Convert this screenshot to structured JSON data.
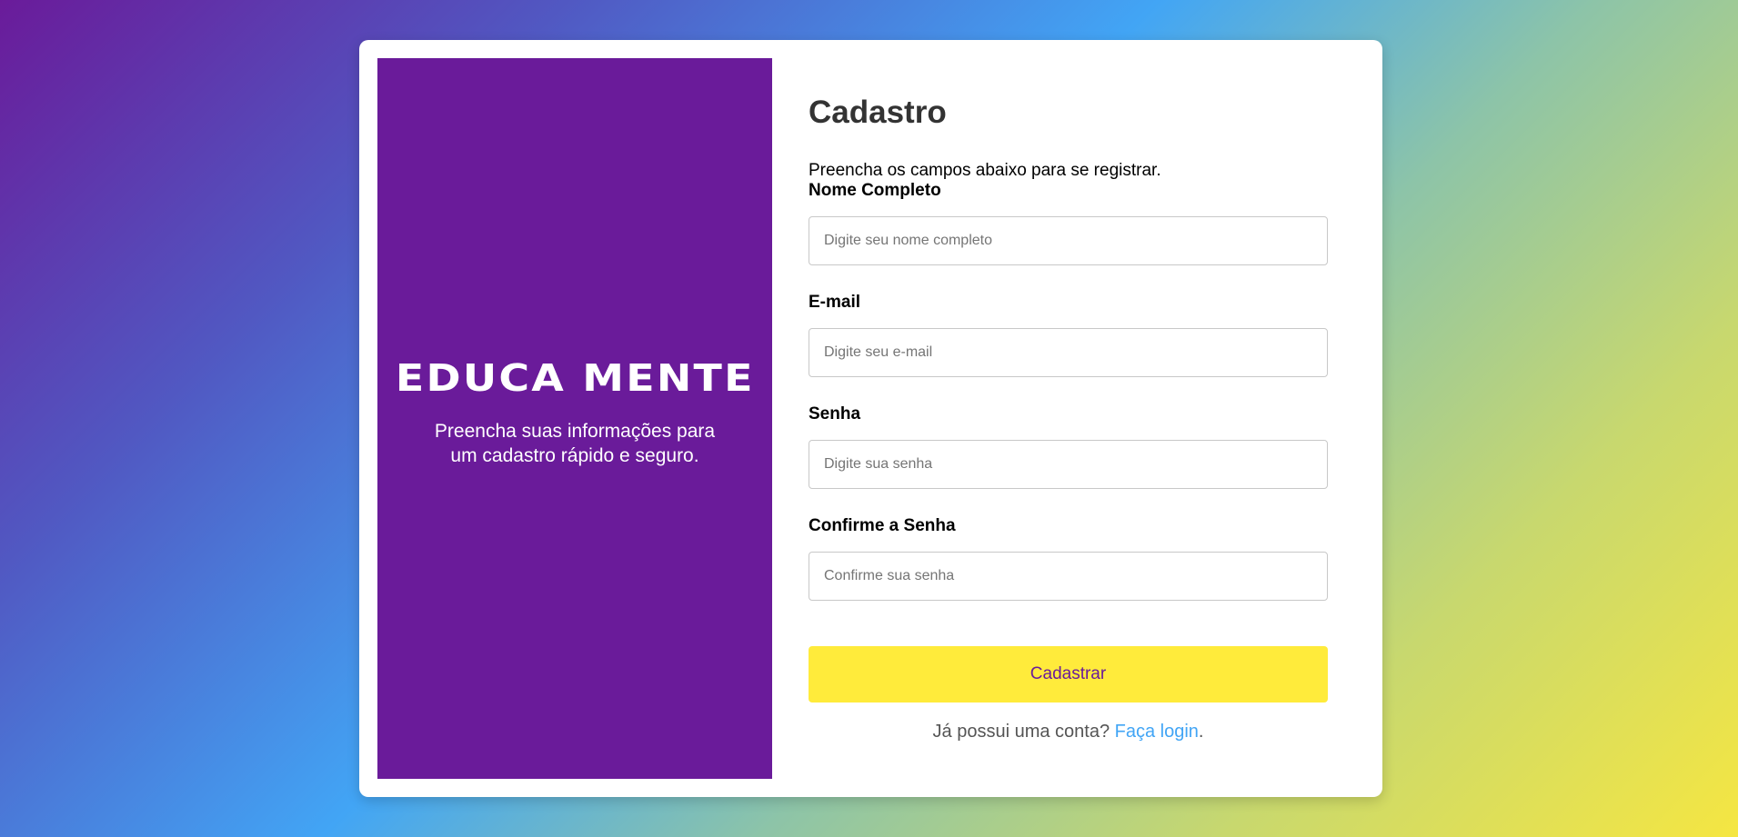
{
  "brand": {
    "name": "EDUCA MENTE",
    "tagline": "Preencha suas informações para um cadastro rápido e seguro."
  },
  "form": {
    "title": "Cadastro",
    "description": "Preencha os campos abaixo para se registrar.",
    "fields": [
      {
        "label": "Nome Completo",
        "placeholder": "Digite seu nome completo",
        "value": ""
      },
      {
        "label": "E-mail",
        "placeholder": "Digite seu e-mail",
        "value": ""
      },
      {
        "label": "Senha",
        "placeholder": "Digite sua senha",
        "value": ""
      },
      {
        "label": "Confirme a Senha",
        "placeholder": "Confirme sua senha",
        "value": ""
      }
    ],
    "submit_label": "Cadastrar",
    "login_prompt": "Já possui uma conta?",
    "login_link": "Faça login",
    "login_suffix": "."
  },
  "colors": {
    "brand_purple": "#6a1b9a",
    "button_yellow": "#ffeb3b",
    "link_blue": "#42a5f5"
  }
}
